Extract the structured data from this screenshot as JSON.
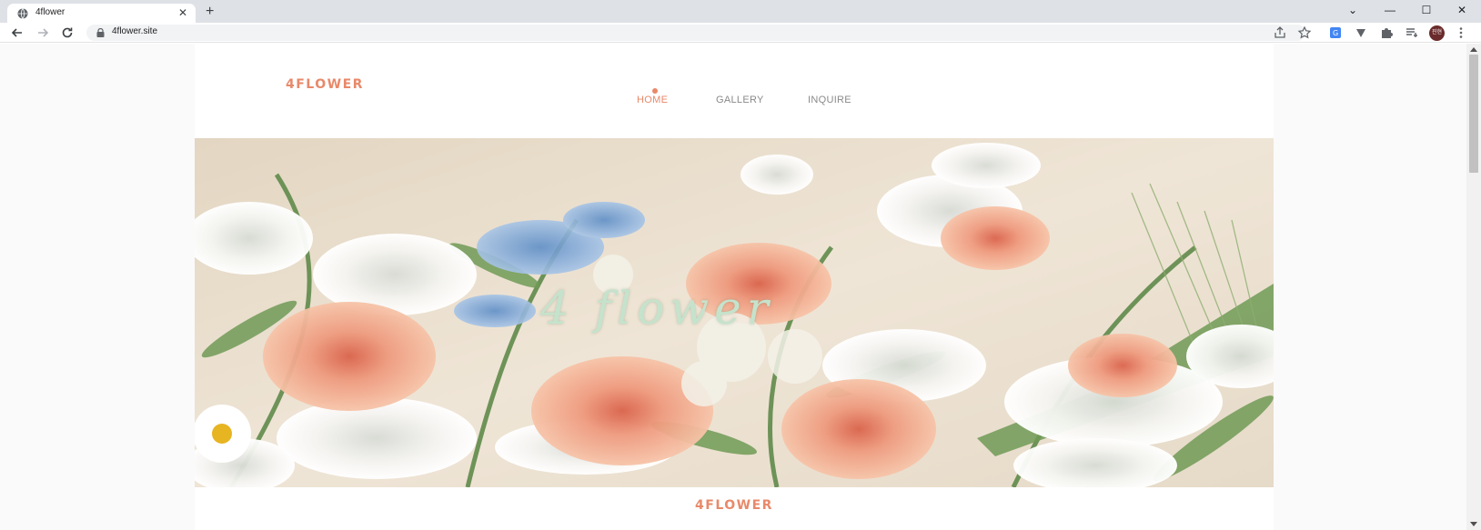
{
  "browser": {
    "tab_title": "4flower",
    "url": "4flower.site",
    "profile_initials": "진현"
  },
  "site": {
    "logo": "4FLOWER",
    "nav": [
      {
        "label": "HOME",
        "active": true
      },
      {
        "label": "GALLERY",
        "active": false
      },
      {
        "label": "INQUIRE",
        "active": false
      }
    ],
    "hero_title": "4 flower",
    "section_title": "4FLOWER"
  },
  "colors": {
    "accent": "#e8896a",
    "hero_text": "#c5e3cc"
  }
}
